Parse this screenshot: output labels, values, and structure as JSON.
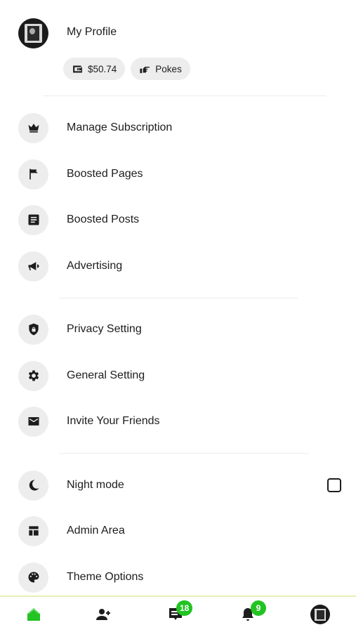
{
  "profile": {
    "name": "My Profile",
    "avatar_icon": "user-photo-avatar",
    "wallet_label": "$50.74",
    "wallet_icon": "wallet-icon",
    "pokes_label": "Pokes",
    "pokes_icon": "poke-hand-icon"
  },
  "menu": {
    "manage_subscription": "Manage Subscription",
    "boosted_pages": "Boosted Pages",
    "boosted_posts": "Boosted Posts",
    "advertising": "Advertising",
    "privacy_setting": "Privacy Setting",
    "general_setting": "General Setting",
    "invite_friends": "Invite Your Friends",
    "night_mode": "Night mode",
    "admin_area": "Admin Area",
    "theme_options": "Theme Options"
  },
  "night_mode_checked": false,
  "bottom_nav": {
    "messages_badge": "18",
    "notifications_badge": "9",
    "accent_color": "#22c322"
  }
}
